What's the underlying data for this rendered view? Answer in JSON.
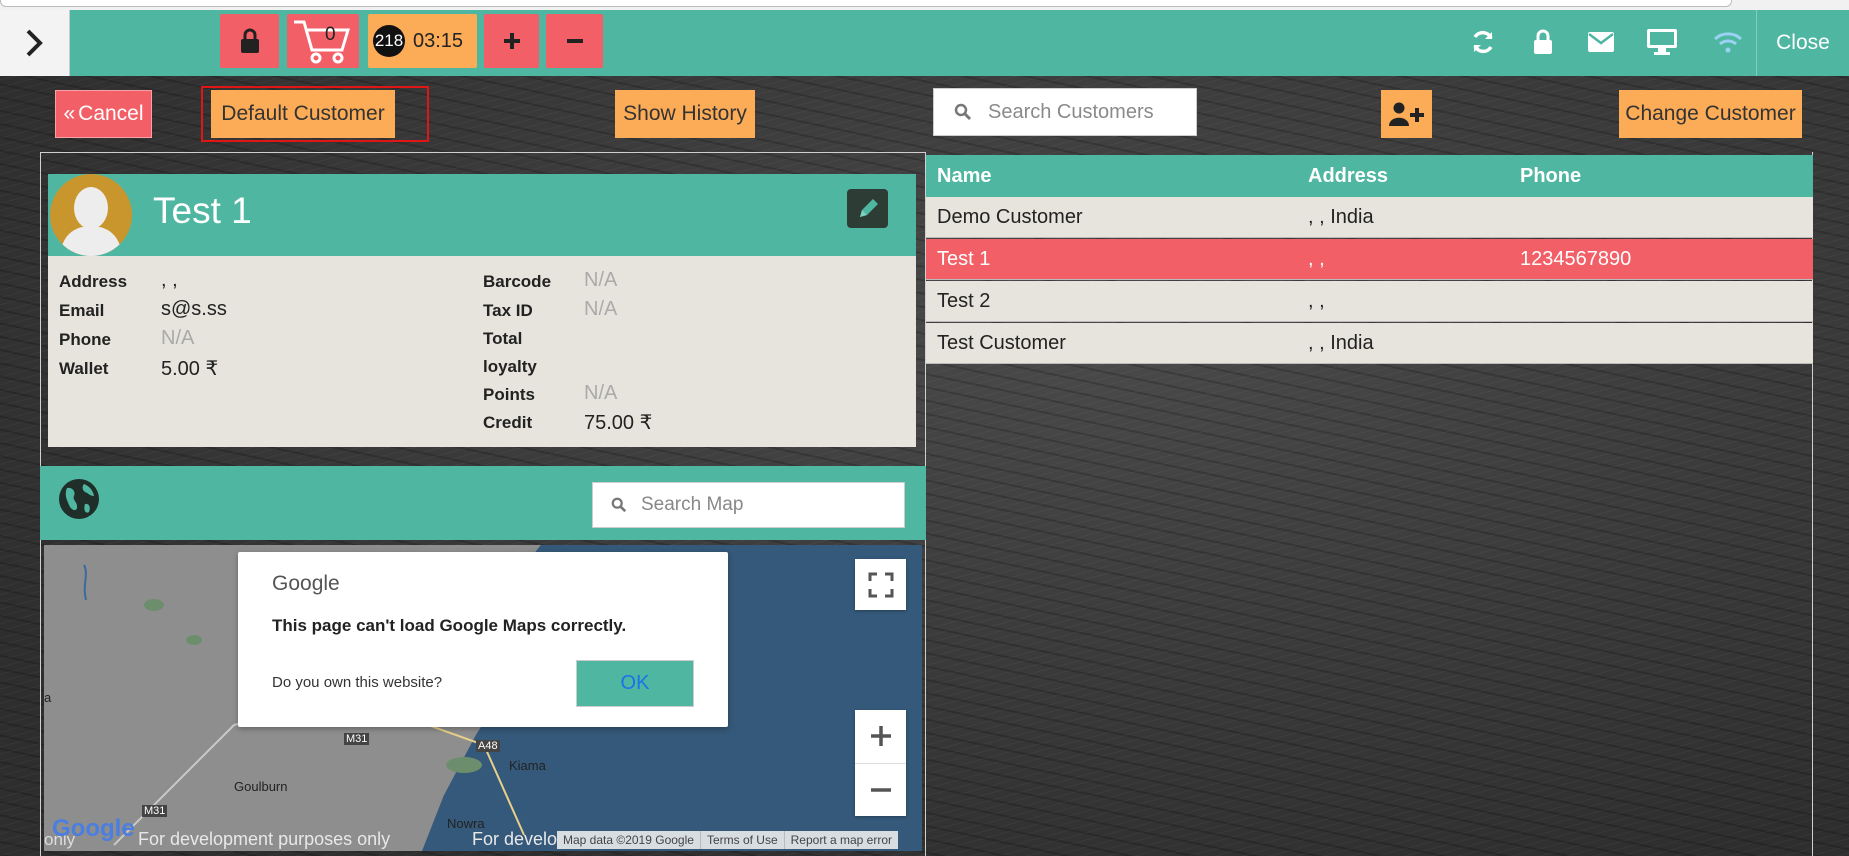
{
  "topbar": {
    "cart_count": "0",
    "badge_number": "218",
    "timer": "03:15",
    "close_label": "Close"
  },
  "actions": {
    "cancel_label": "Cancel",
    "default_customer_label": "Default Customer",
    "show_history_label": "Show History",
    "search_placeholder": "Search Customers",
    "change_customer_label": "Change Customer"
  },
  "profile": {
    "name": "Test 1",
    "left_fields": [
      {
        "label": "Address",
        "value": ", ,"
      },
      {
        "label": "Email",
        "value": "s@s.ss"
      },
      {
        "label": "Phone",
        "value": "N/A"
      },
      {
        "label": "Wallet",
        "value": "5.00 ₹"
      }
    ],
    "right_fields": [
      {
        "label": "Barcode",
        "value": "N/A"
      },
      {
        "label": "Tax ID",
        "value": "N/A"
      },
      {
        "label": "Total",
        "value": ""
      },
      {
        "label": "loyalty",
        "value": ""
      },
      {
        "label": "Points",
        "value": "N/A"
      },
      {
        "label": "Credit",
        "value": "75.00 ₹"
      }
    ]
  },
  "map": {
    "search_placeholder": "Search Map",
    "dialog_brand": "Google",
    "dialog_title": "This page can't load Google Maps correctly.",
    "dialog_question": "Do you own this website?",
    "dialog_ok": "OK",
    "labels": [
      "M31",
      "A48",
      "Kiama",
      "Goulburn",
      "M31",
      "Nowra",
      "a",
      "only"
    ],
    "watermark_1": "For development purposes only",
    "watermark_2": "For develo",
    "footer": [
      "Map data ©2019 Google",
      "Terms of Use",
      "Report a map error"
    ]
  },
  "table": {
    "headers": [
      "Name",
      "Address",
      "Phone"
    ],
    "rows": [
      {
        "name": "Demo Customer",
        "address": ", , India",
        "phone": ""
      },
      {
        "name": "Test 1",
        "address": ", ,",
        "phone": "1234567890"
      },
      {
        "name": "Test 2",
        "address": ", ,",
        "phone": ""
      },
      {
        "name": "Test Customer",
        "address": ", , India",
        "phone": ""
      }
    ],
    "selected_row": 1
  },
  "colors": {
    "accent": "#4fb6a1",
    "danger": "#f35f67",
    "warning": "#fcab57",
    "panel": "#e6e4dc"
  }
}
